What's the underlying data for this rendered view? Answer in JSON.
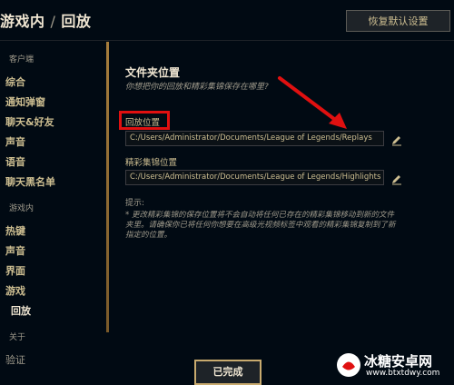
{
  "header": {
    "breadcrumb_parent": "游戏内",
    "breadcrumb_sep": "/",
    "breadcrumb_current": "回放",
    "restore_button": "恢复默认设置"
  },
  "sidebar": {
    "group_client": "客户端",
    "client_items": [
      "综合",
      "通知弹窗",
      "聊天&好友",
      "声音",
      "语音",
      "聊天黑名单"
    ],
    "group_ingame": "游戏内",
    "ingame_items": [
      "热键",
      "声音",
      "界面",
      "游戏",
      "回放"
    ],
    "group_about": "关于",
    "about_items": [
      "验证"
    ],
    "active_item": "回放"
  },
  "main": {
    "title": "文件夹位置",
    "subtitle": "你想把你的回放和精彩集锦保存在哪里?",
    "replays_label": "回放位置",
    "replays_path": "C:/Users/Administrator/Documents/League of Legends/Replays",
    "highlights_label": "精彩集锦位置",
    "highlights_path": "C:/Users/Administrator/Documents/League of Legends/Highlights",
    "hint_label": "提示:",
    "hint_text": "* 更改精彩集锦的保存位置将不会自动将任何已存在的精彩集锦移动到新的文件夹里。请确保你已将任何你想要在高级光视频标签中观看的精彩集锦复制到了新指定的位置。"
  },
  "footer": {
    "done_button": "已完成"
  },
  "watermark": {
    "brand": "冰糖安卓网",
    "url": "www.btxtdwy.com"
  },
  "colors": {
    "background": "#010a13",
    "gold": "#c8aa6e",
    "highlight_red": "#e01010",
    "arrow_red": "#e01010"
  }
}
